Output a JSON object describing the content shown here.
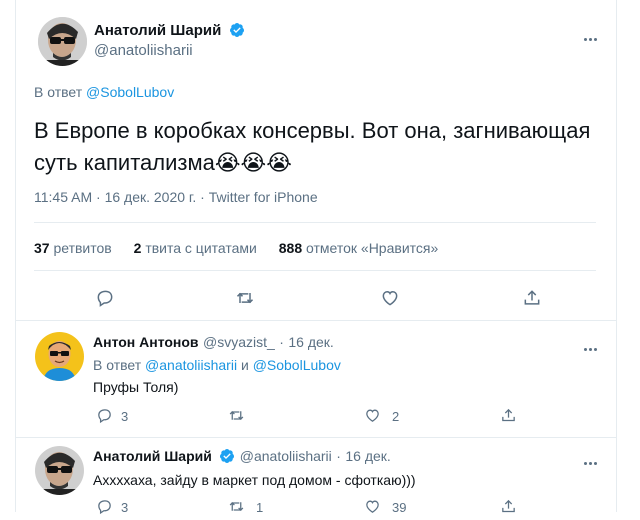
{
  "colors": {
    "accent": "#1da1f2",
    "link": "#1b95e0",
    "muted": "#5b7083",
    "text": "#0f1419",
    "border": "#e6ecf0"
  },
  "main_tweet": {
    "author_name": "Анатолий Шарий",
    "author_handle": "@anatoliisharii",
    "reply_prefix": "В ответ",
    "reply_to": "@SobolLubov",
    "text": "В Европе в коробках консервы. Вот она, загнивающая суть капитализма",
    "emoji": "😭😭😭",
    "time": "11:45 AM",
    "date": "16 дек. 2020 г.",
    "source": "Twitter for iPhone",
    "separator": "·",
    "stats": {
      "retweets_count": "37",
      "retweets_label": "ретвитов",
      "quotes_count": "2",
      "quotes_label": "твита с цитатами",
      "likes_count": "888",
      "likes_label": "отметок «Нравится»"
    }
  },
  "reply_1": {
    "author_name": "Антон Антонов",
    "author_handle": "@svyazist_",
    "date": "16 дек.",
    "separator": "·",
    "reply_prefix": "В ответ",
    "reply_to_1": "@anatoliisharii",
    "conj": "и",
    "reply_to_2": "@SobolLubov",
    "text": "Пруфы Толя)",
    "replies": "3",
    "likes": "2"
  },
  "reply_2": {
    "author_name": "Анатолий Шарий",
    "author_handle": "@anatoliisharii",
    "date": "16 дек.",
    "separator": "·",
    "text": "Аххххаха, зайду в маркет под домом - сфоткаю)))",
    "replies": "3",
    "retweets": "1",
    "likes": "39"
  }
}
